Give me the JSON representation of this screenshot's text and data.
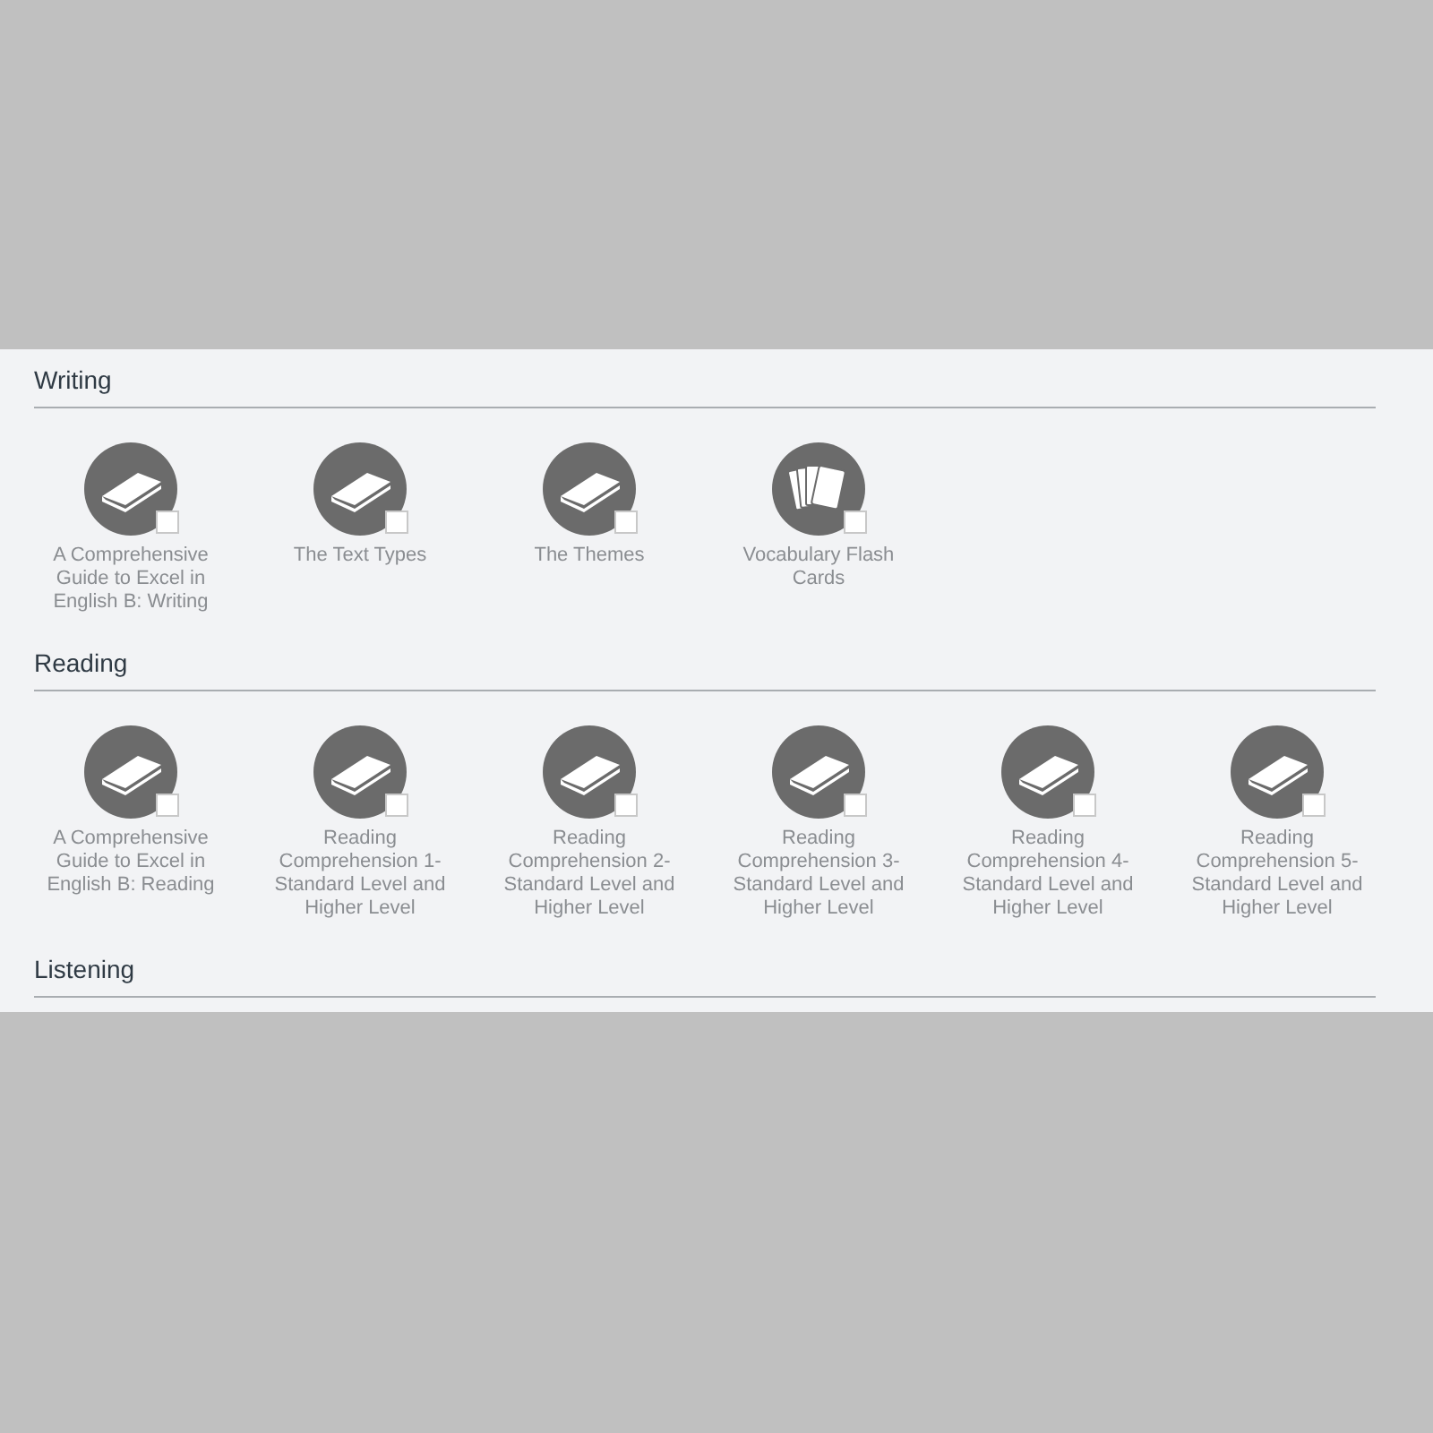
{
  "sections": [
    {
      "title": "Writing",
      "items": [
        {
          "kind": "book",
          "label": "A Comprehensive Guide to Excel in English B: Writing",
          "checked": false
        },
        {
          "kind": "book",
          "label": "The Text Types",
          "checked": false
        },
        {
          "kind": "book",
          "label": "The Themes",
          "checked": false
        },
        {
          "kind": "cards",
          "label": "Vocabulary Flash Cards",
          "checked": false
        }
      ]
    },
    {
      "title": "Reading",
      "items": [
        {
          "kind": "book",
          "label": "A Comprehensive Guide to Excel in English B: Reading",
          "checked": false
        },
        {
          "kind": "book",
          "label": "Reading Comprehension 1- Standard Level and Higher Level",
          "checked": false
        },
        {
          "kind": "book",
          "label": "Reading Comprehension 2- Standard Level and Higher Level",
          "checked": false
        },
        {
          "kind": "book",
          "label": "Reading Comprehension 3- Standard Level and Higher Level",
          "checked": false
        },
        {
          "kind": "book",
          "label": "Reading Comprehension 4- Standard Level and Higher Level",
          "checked": false
        },
        {
          "kind": "book",
          "label": "Reading Comprehension 5- Standard Level and Higher Level",
          "checked": false
        }
      ]
    },
    {
      "title": "Listening"
    }
  ]
}
